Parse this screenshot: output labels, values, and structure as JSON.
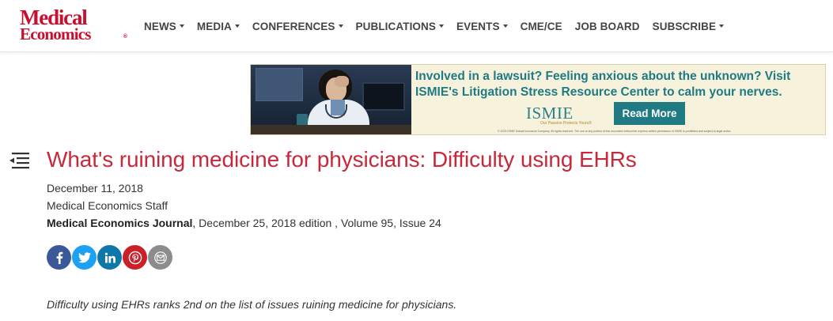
{
  "site": {
    "logo_line1": "Medical",
    "logo_line2": "Economics",
    "logo_mark": "®",
    "brand_color": "#c8102e"
  },
  "nav": {
    "items": [
      {
        "label": "NEWS",
        "has_dropdown": true
      },
      {
        "label": "MEDIA",
        "has_dropdown": true
      },
      {
        "label": "CONFERENCES",
        "has_dropdown": true
      },
      {
        "label": "PUBLICATIONS",
        "has_dropdown": true
      },
      {
        "label": "EVENTS",
        "has_dropdown": true
      },
      {
        "label": "CME/CE",
        "has_dropdown": false
      },
      {
        "label": "JOB BOARD",
        "has_dropdown": false
      },
      {
        "label": "SUBSCRIBE",
        "has_dropdown": true
      }
    ]
  },
  "ad": {
    "headline_line1": "Involved in a lawsuit? Feeling anxious about the unknown? Visit",
    "headline_line2": "ISMIE's Litigation Stress Resource Center to calm your nerves.",
    "brand": "ISMIE",
    "brand_tagline": "Our Passion Protects Yours®",
    "cta_label": "Read More",
    "fine_print": "© 2023 ISMIE Mutual Insurance Company. All rights reserved. The use of any portion of this document without the express written permission of ISMIE is prohibited and subject to legal action.",
    "accent_color": "#1f7a84"
  },
  "article": {
    "title": "What's ruining medicine for physicians: Difficulty using EHRs",
    "date": "December 11, 2018",
    "author": "Medical Economics Staff",
    "journal_name": "Medical Economics Journal",
    "journal_details": ", December 25, 2018 edition , Volume 95, Issue 24",
    "lede": "Difficulty using EHRs ranks 2nd on the list of issues ruining medicine for physicians.",
    "title_color": "#c8283a"
  },
  "share": {
    "buttons": [
      {
        "name": "facebook",
        "icon": "facebook-icon",
        "color": "#3b5998"
      },
      {
        "name": "twitter",
        "icon": "twitter-icon",
        "color": "#1da1f2"
      },
      {
        "name": "linkedin",
        "icon": "linkedin-icon",
        "color": "#0e76a8"
      },
      {
        "name": "pinterest",
        "icon": "pinterest-icon",
        "color": "#cb2027"
      },
      {
        "name": "email",
        "icon": "envelope-icon",
        "color": "#8c8c8c"
      }
    ]
  }
}
